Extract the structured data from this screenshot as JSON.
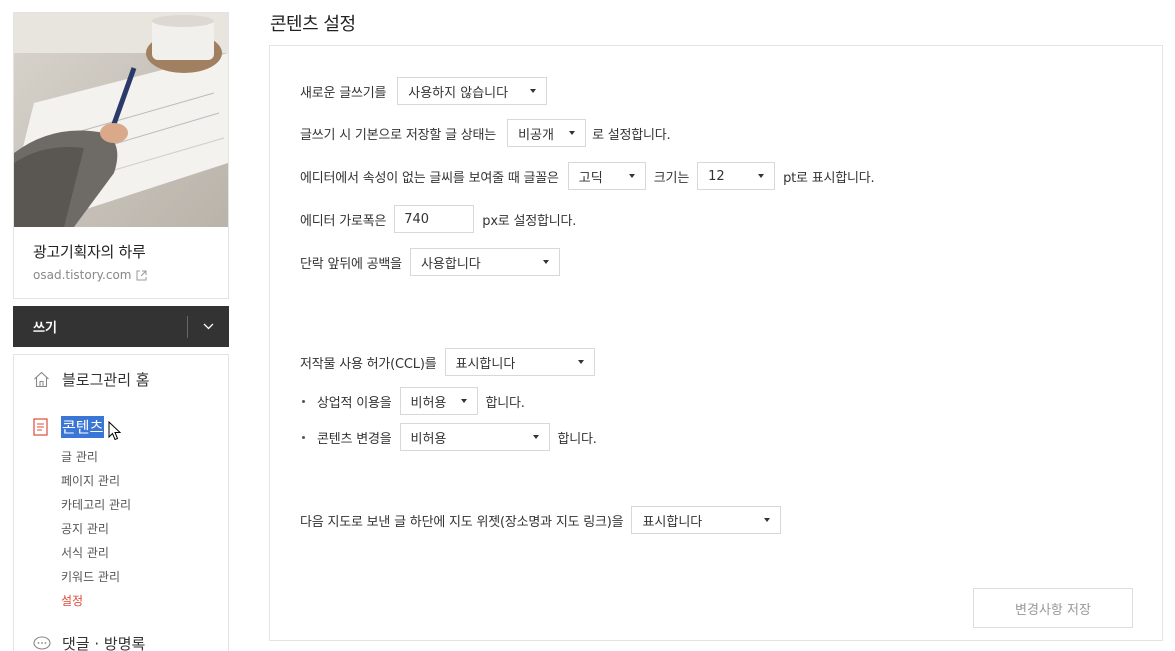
{
  "page_title": "콘텐츠 설정",
  "sidebar": {
    "blog_name": "광고기획자의 하루",
    "blog_url": "osad.tistory.com",
    "write_label": "쓰기",
    "home_label": "블로그관리 홈",
    "contents_label": "콘텐츠",
    "submenu": [
      "글 관리",
      "페이지 관리",
      "카테고리 관리",
      "공지 관리",
      "서식 관리",
      "키워드 관리",
      "설정"
    ],
    "comments_label": "댓글 · 방명록"
  },
  "settings": {
    "new_writing": {
      "label": "새로운 글쓰기를",
      "value": "사용하지 않습니다"
    },
    "default_status": {
      "prefix": "글쓰기 시 기본으로 저장할 글 상태는",
      "value": "비공개",
      "suffix": "로 설정합니다."
    },
    "font": {
      "prefix": "에디터에서 속성이 없는 글씨를 보여줄 때 글꼴은",
      "font_value": "고딕",
      "size_label": "크기는",
      "size_value": "12",
      "suffix": "pt로 표시합니다."
    },
    "editor_width": {
      "prefix": "에디터 가로폭은",
      "value": "740",
      "suffix": "px로 설정합니다."
    },
    "paragraph_space": {
      "label": "단락 앞뒤에 공백을",
      "value": "사용합니다"
    },
    "ccl": {
      "label": "저작물 사용 허가(CCL)를",
      "value": "표시합니다"
    },
    "commercial": {
      "label": "상업적 이용을",
      "value": "비허용",
      "suffix": "합니다."
    },
    "modify": {
      "label": "콘텐츠 변경을",
      "value": "비허용",
      "suffix": "합니다."
    },
    "map_widget": {
      "label": "다음 지도로 보낸 글 하단에 지도 위젯(장소명과 지도 링크)을",
      "value": "표시합니다"
    }
  },
  "save_label": "변경사항 저장",
  "colors": {
    "accent": "#e04b38",
    "highlight": "#3a76d6",
    "write_bar": "#333333"
  }
}
